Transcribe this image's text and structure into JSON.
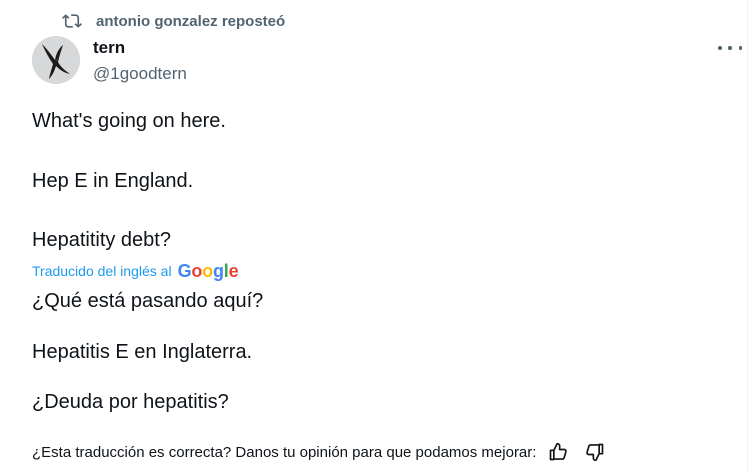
{
  "repost": {
    "icon": "repost-icon",
    "text": "antonio gonzalez reposteó"
  },
  "author": {
    "display_name": "tern",
    "handle": "@1goodtern",
    "avatar": "tern-bird-avatar"
  },
  "menu": {
    "icon": "more-horizontal-icon"
  },
  "original": {
    "lines": [
      "What's going on here.",
      "Hep E in England.",
      "Hepatitity debt?"
    ]
  },
  "translation": {
    "attribution": "Traducido del inglés al",
    "provider": "Google",
    "lines": [
      "¿Qué está pasando aquí?",
      "Hepatitis E en Inglaterra.",
      "¿Deuda por hepatitis?"
    ]
  },
  "feedback": {
    "question": "¿Esta traducción es correcta? Danos tu opinión para que podamos mejorar:",
    "up_icon": "thumbs-up-icon",
    "down_icon": "thumbs-down-icon"
  },
  "colors": {
    "text": "#0f1419",
    "secondary": "#536471",
    "link": "#1d9bf0"
  }
}
